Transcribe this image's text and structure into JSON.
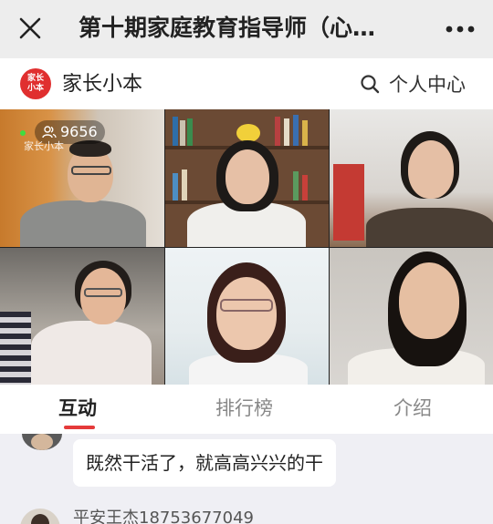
{
  "titlebar": {
    "title": "第十期家庭教育指导师（心…",
    "close_icon": "close-icon",
    "more_icon": "more-dots-icon"
  },
  "appbar": {
    "logo_text": "家长小本",
    "brand": "家长小本",
    "profile_label": "个人中心",
    "search_icon": "search-icon"
  },
  "video": {
    "viewer_count": "9656",
    "watermark": "家长小本",
    "participants": 6
  },
  "tabs": [
    {
      "label": "互动",
      "active": true
    },
    {
      "label": "排行榜",
      "active": false
    },
    {
      "label": "介绍",
      "active": false
    }
  ],
  "chat": {
    "messages": [
      {
        "text": "既然干活了，就高高兴兴的干"
      },
      {
        "user": "平安王杰18753677049"
      }
    ]
  },
  "colors": {
    "accent": "#e53a3a",
    "logo": "#e02f2f"
  }
}
